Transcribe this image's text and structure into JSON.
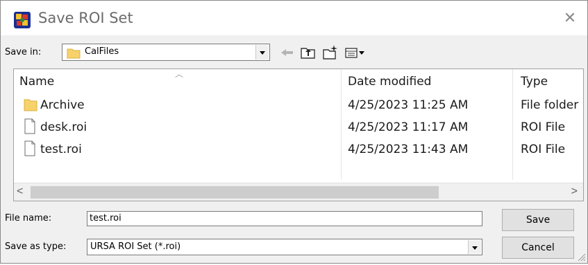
{
  "window": {
    "title": "Save ROI Set",
    "close_symbol": "✕"
  },
  "toolbar": {
    "save_in_label": "Save in:",
    "save_in_value": "CalFiles",
    "icons": [
      "back-arrow-icon",
      "up-folder-icon",
      "new-folder-icon",
      "view-menu-icon"
    ]
  },
  "file_list": {
    "columns": [
      "Name",
      "Date modified",
      "Type"
    ],
    "rows": [
      {
        "name": "Archive",
        "date": "4/25/2023 11:25 AM",
        "type": "File folder",
        "icon": "folder-icon"
      },
      {
        "name": "desk.roi",
        "date": "4/25/2023 11:17 AM",
        "type": "ROI File",
        "icon": "file-icon"
      },
      {
        "name": "test.roi",
        "date": "4/25/2023 11:43 AM",
        "type": "ROI File",
        "icon": "file-icon"
      }
    ],
    "scroll_left": "<",
    "scroll_right": ">"
  },
  "form": {
    "file_name_label": "File name:",
    "file_name_value": "test.roi",
    "save_type_label": "Save as type:",
    "save_type_value": "URSA ROI Set (*.roi)"
  },
  "buttons": {
    "save": "Save",
    "cancel": "Cancel"
  },
  "colors": {
    "folder": "#f7d26a",
    "scroll_thumb": "#cdcdcd",
    "dialog_bg": "#f0f0f0"
  }
}
